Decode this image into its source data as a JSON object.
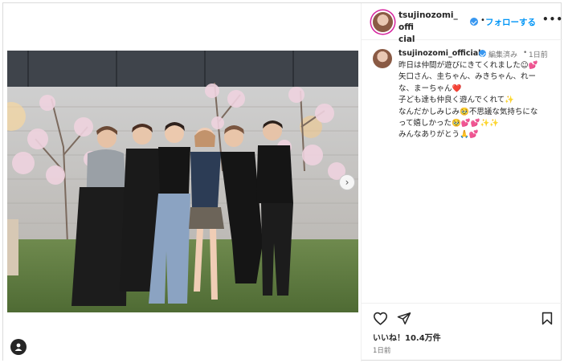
{
  "post": {
    "username": "tsujinozomi_official",
    "username_line1": "tsujinozomi_offi",
    "username_line2": "cial",
    "follow_label": "フォローする",
    "separator": "•",
    "more_label": "•••",
    "edited_label": "編集済み",
    "time_label": "1日前",
    "caption_lines": [
      "昨日は仲間が遊びにきてくれました☺💕",
      "矢口さん、圭ちゃん、みきちゃん、れー",
      "な、まーちゃん❤️",
      "子ども達も仲良く遊んでくれて✨",
      "なんだかしみじみ🥹不思議な気持ちにな",
      "って嬉しかった🥹💕💕✨✨",
      "みんなありがとう🙏💕"
    ],
    "likes_label": "いいね！10.4万件",
    "ago_label": "1日前"
  },
  "icons": {
    "verified": "verified-badge-icon",
    "like": "heart-icon",
    "share": "paper-plane-icon",
    "save": "bookmark-icon",
    "next": "chevron-right-icon",
    "user_tag": "person-icon"
  },
  "colors": {
    "accent": "#0095f6",
    "verified": "#3897f0",
    "muted": "#737373",
    "text": "#262626"
  }
}
